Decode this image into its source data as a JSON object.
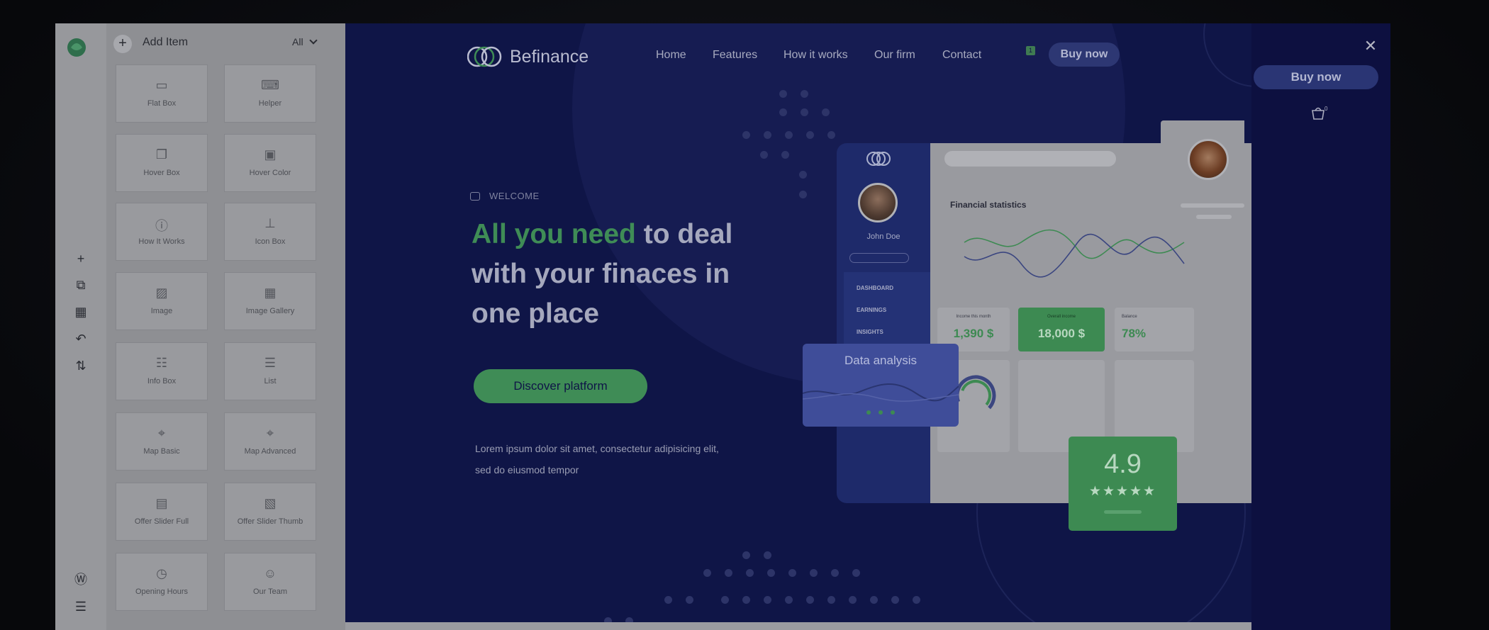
{
  "builder": {
    "add_item_label": "Add Item",
    "filter_label": "All",
    "widgets": [
      {
        "label": "Flat Box",
        "icon": "flat-box-icon"
      },
      {
        "label": "Helper",
        "icon": "helper-icon"
      },
      {
        "label": "Hover Box",
        "icon": "hover-box-icon"
      },
      {
        "label": "Hover Color",
        "icon": "hover-color-icon"
      },
      {
        "label": "How It Works",
        "icon": "how-it-works-icon"
      },
      {
        "label": "Icon Box",
        "icon": "icon-box-icon"
      },
      {
        "label": "Image",
        "icon": "image-icon"
      },
      {
        "label": "Image Gallery",
        "icon": "image-gallery-icon"
      },
      {
        "label": "Info Box",
        "icon": "info-box-icon"
      },
      {
        "label": "List",
        "icon": "list-icon"
      },
      {
        "label": "Map Basic",
        "icon": "map-pin-icon"
      },
      {
        "label": "Map Advanced",
        "icon": "map-pin-icon"
      },
      {
        "label": "Offer Slider Full",
        "icon": "offer-slider-full-icon"
      },
      {
        "label": "Offer Slider Thumb",
        "icon": "offer-slider-thumb-icon"
      },
      {
        "label": "Opening Hours",
        "icon": "clock-icon"
      },
      {
        "label": "Our Team",
        "icon": "user-icon"
      }
    ]
  },
  "site": {
    "brand": "Befinance",
    "nav": [
      "Home",
      "Features",
      "How it works",
      "Our firm",
      "Contact"
    ],
    "buy_now": "Buy now",
    "welcome": "WELCOME",
    "hero_accent": "All you need",
    "hero_rest": " to deal with your finaces in one place",
    "cta": "Discover platform",
    "lorem": "Lorem ipsum dolor sit amet, consectetur adipisicing elit, sed do eiusmod tempor"
  },
  "dashboard": {
    "user_name": "John Doe",
    "menu": [
      "DASHBOARD",
      "EARNINGS",
      "INSIGHTS"
    ],
    "title": "Financial statistics",
    "income_label": "Income this month",
    "income_value": "1,390 $",
    "overall_label": "Overall income",
    "overall_value": "18,000 $",
    "balance_label": "Balance",
    "balance_value": "78%",
    "data_analysis": "Data analysis",
    "rating": "4.9",
    "stars": "★★★★★"
  },
  "sidebar_right": {
    "buy_now": "Buy now"
  },
  "colors": {
    "site_bg": "#0f1547",
    "accent_green": "#3f8c56",
    "panel_bg": "#8e8f93"
  }
}
